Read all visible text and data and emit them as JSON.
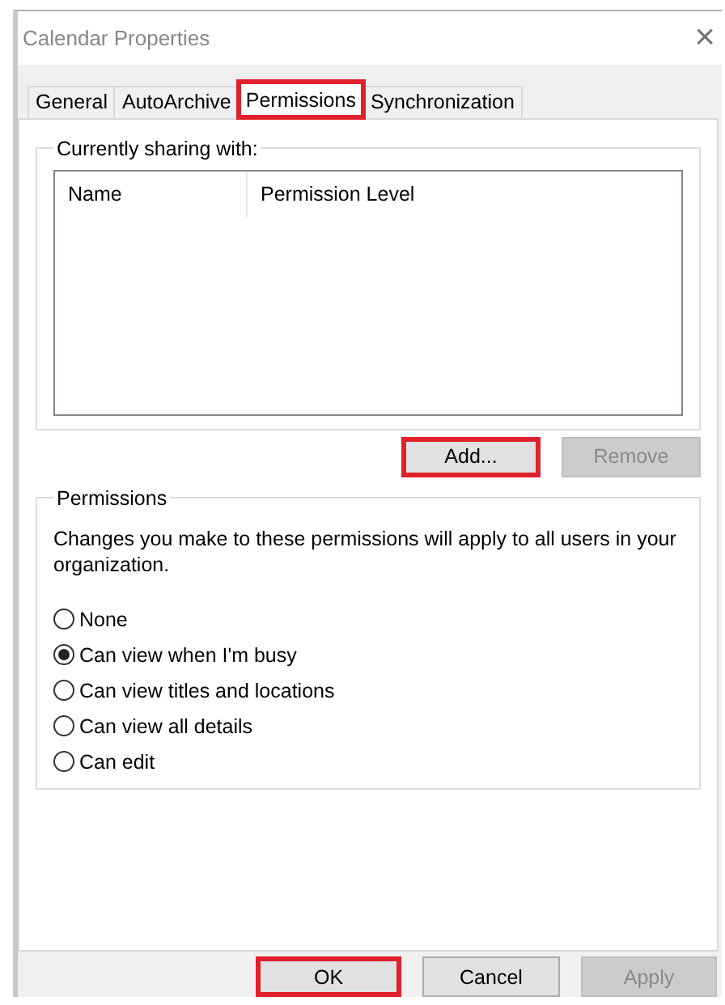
{
  "window": {
    "title": "Calendar Properties",
    "close": "×"
  },
  "tabs": [
    {
      "label": "General",
      "selected": false,
      "highlighted": false
    },
    {
      "label": "AutoArchive",
      "selected": false,
      "highlighted": false
    },
    {
      "label": "Permissions",
      "selected": true,
      "highlighted": true
    },
    {
      "label": "Synchronization",
      "selected": false,
      "highlighted": false
    }
  ],
  "sharing": {
    "title": "Currently sharing with:",
    "columns": [
      "Name",
      "Permission Level"
    ],
    "buttons": [
      {
        "label": "Add...",
        "disabled": false,
        "highlighted": true
      },
      {
        "label": "Remove",
        "disabled": true,
        "highlighted": false
      }
    ]
  },
  "permissions": {
    "title": "Permissions",
    "note": "Changes you make to these permissions will apply to all users in your organization.",
    "options": [
      {
        "label": "None",
        "selected": false
      },
      {
        "label": "Can view when I'm busy",
        "selected": true
      },
      {
        "label": "Can view titles and locations",
        "selected": false
      },
      {
        "label": "Can view all details",
        "selected": false
      },
      {
        "label": "Can edit",
        "selected": false
      }
    ]
  },
  "buttons": [
    {
      "label": "OK",
      "disabled": false,
      "highlighted": true
    },
    {
      "label": "Cancel",
      "disabled": false,
      "highlighted": false
    },
    {
      "label": "Apply",
      "disabled": true,
      "highlighted": false
    }
  ]
}
